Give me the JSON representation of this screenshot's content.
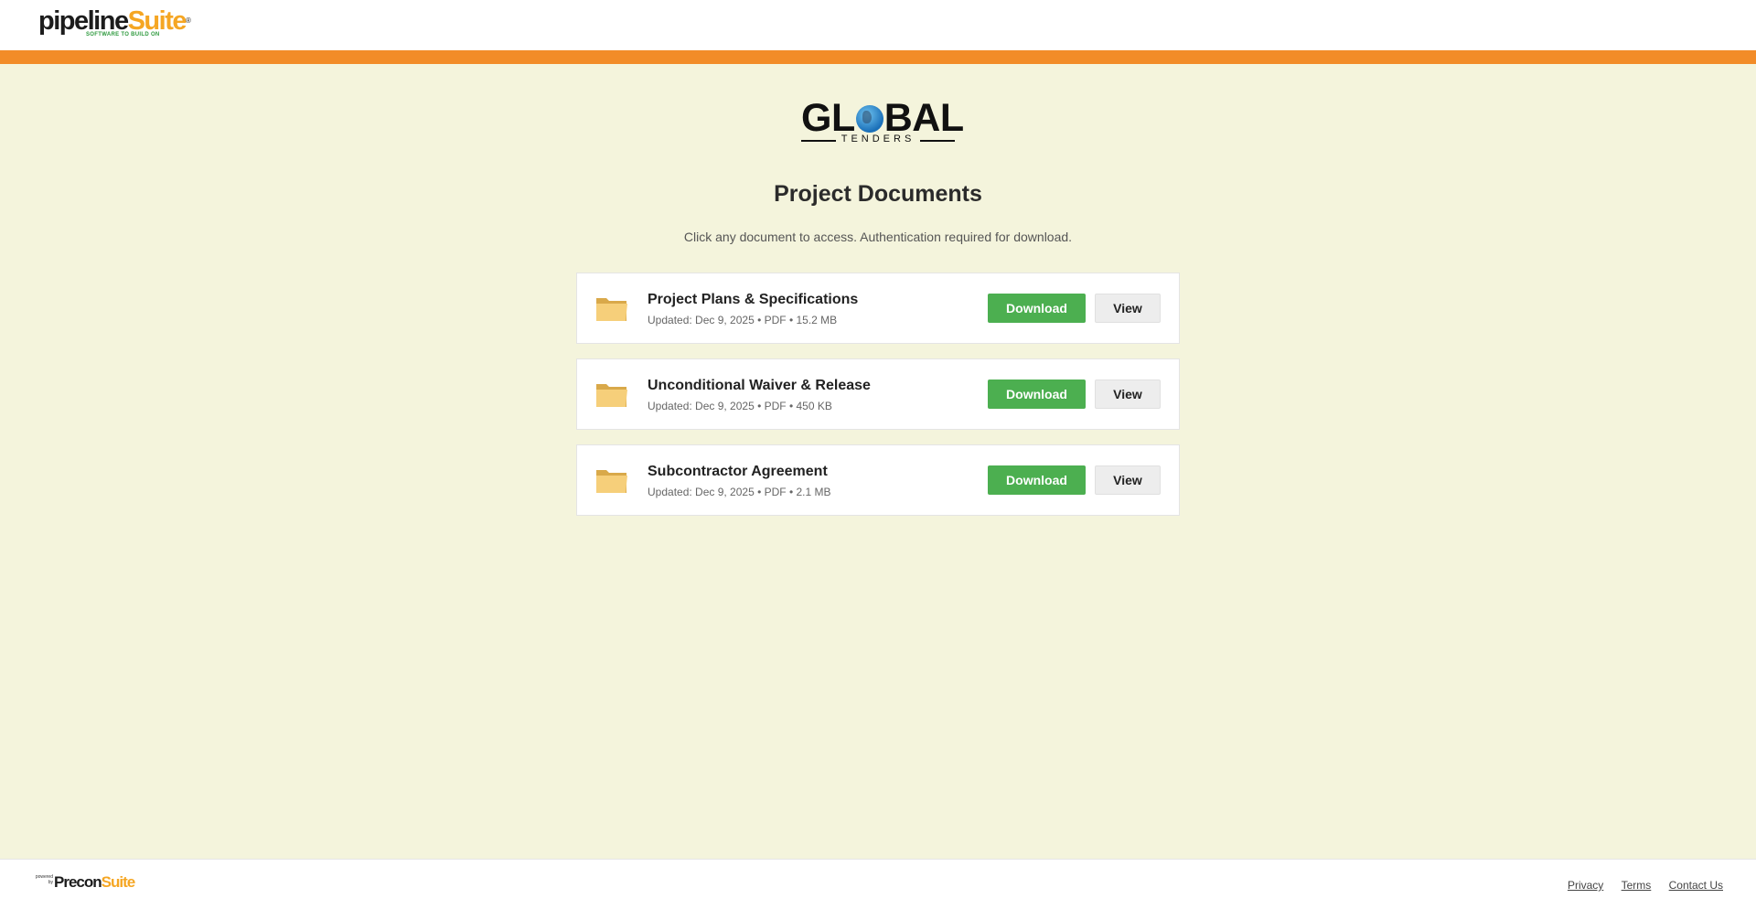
{
  "header": {
    "brand_primary": "pipeline",
    "brand_secondary": "Suite",
    "brand_registered": "®",
    "brand_tagline": "SOFTWARE TO BUILD ON",
    "colors": {
      "band": "#f28c28"
    }
  },
  "hero": {
    "logo_left": "GL",
    "logo_right": "BAL",
    "logo_sub": "TENDERS",
    "title": "Project Documents",
    "subtitle": "Click any document to access. Authentication required for download."
  },
  "documents": [
    {
      "title": "Project Plans & Specifications",
      "meta": "Updated: Dec 9, 2025 • PDF • 15.2 MB",
      "icon": "folder-icon",
      "download_label": "Download",
      "view_label": "View"
    },
    {
      "title": "Unconditional Waiver & Release",
      "meta": "Updated: Dec 9, 2025 • PDF • 450 KB",
      "icon": "folder-icon",
      "download_label": "Download",
      "view_label": "View"
    },
    {
      "title": "Subcontractor Agreement",
      "meta": "Updated: Dec 9, 2025 • PDF • 2.1 MB",
      "icon": "folder-icon",
      "download_label": "Download",
      "view_label": "View"
    }
  ],
  "footer": {
    "powered_by": "powered by",
    "brand_primary": "Precon",
    "brand_secondary": "Suite",
    "links": [
      "Privacy",
      "Terms",
      "Contact Us"
    ]
  },
  "colors": {
    "background": "#f4f4dc",
    "download_button": "#4caf50",
    "accent": "#f5a623"
  }
}
